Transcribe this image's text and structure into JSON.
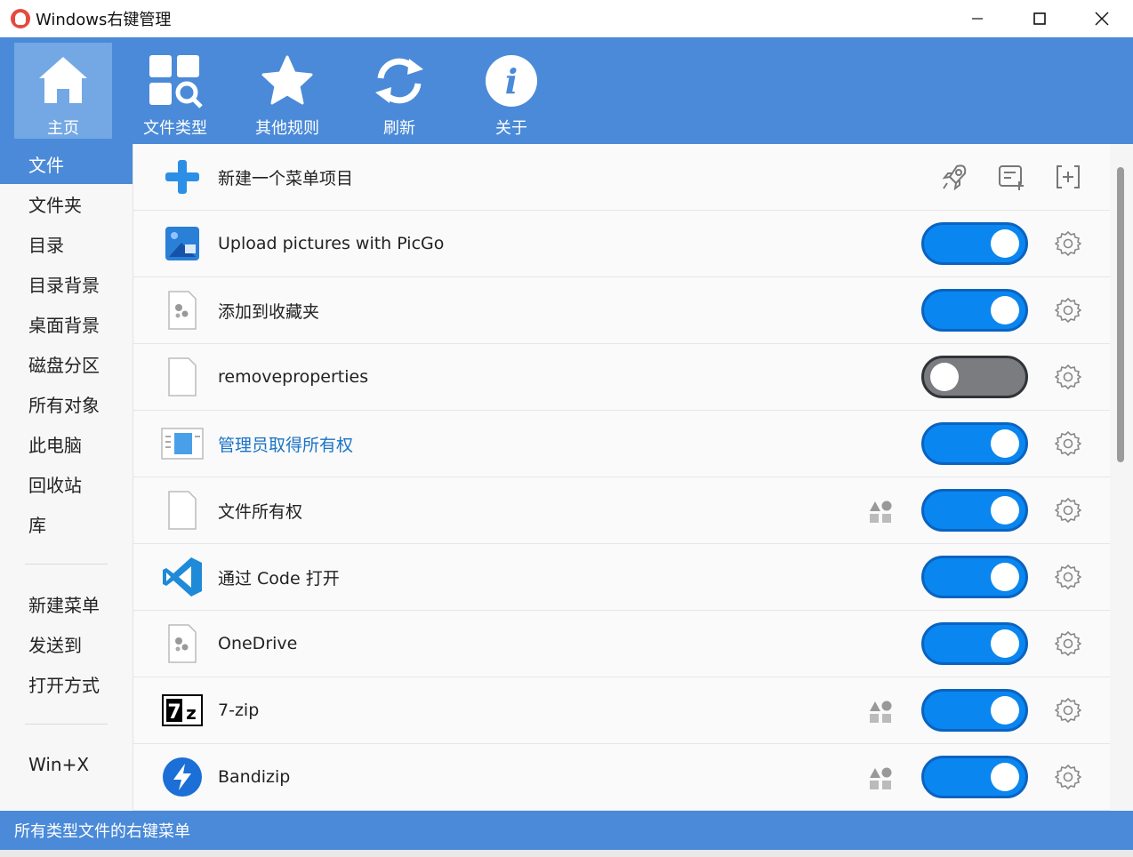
{
  "window": {
    "title": "Windows右键管理"
  },
  "toolbar": {
    "items": [
      {
        "label": "主页",
        "icon": "home-icon"
      },
      {
        "label": "文件类型",
        "icon": "file-types-icon"
      },
      {
        "label": "其他规则",
        "icon": "star-icon"
      },
      {
        "label": "刷新",
        "icon": "refresh-icon"
      },
      {
        "label": "关于",
        "icon": "info-icon"
      }
    ]
  },
  "sidebar": {
    "items": [
      "文件",
      "文件夹",
      "目录",
      "目录背景",
      "桌面背景",
      "磁盘分区",
      "所有对象",
      "此电脑",
      "回收站",
      "库"
    ],
    "items2": [
      "新建菜单",
      "发送到",
      "打开方式"
    ],
    "items3": [
      "Win+X"
    ],
    "active": "文件"
  },
  "main": {
    "new_item_label": "新建一个菜单项目",
    "rows": [
      {
        "label": "Upload pictures with PicGo",
        "enabled": true,
        "icon": "picgo-icon"
      },
      {
        "label": "添加到收藏夹",
        "enabled": true,
        "icon": "settings-file-icon"
      },
      {
        "label": "removeproperties",
        "enabled": false,
        "icon": "blank-file-icon"
      },
      {
        "label": "管理员取得所有权",
        "enabled": true,
        "icon": "window-icon"
      },
      {
        "label": "文件所有权",
        "enabled": true,
        "icon": "blank-file-icon"
      },
      {
        "label": "通过 Code 打开",
        "enabled": true,
        "icon": "vscode-icon"
      },
      {
        "label": "OneDrive",
        "enabled": true,
        "icon": "settings-file-icon"
      },
      {
        "label": "7-zip",
        "enabled": true,
        "icon": "7zip-icon"
      },
      {
        "label": "Bandizip",
        "enabled": true,
        "icon": "bandizip-icon"
      }
    ]
  },
  "statusbar": {
    "text": "所有类型文件的右键菜单"
  },
  "colors": {
    "accent": "#4a8ad8",
    "toggle_on": "#0a86f0",
    "toggle_off": "#7a7c80"
  }
}
